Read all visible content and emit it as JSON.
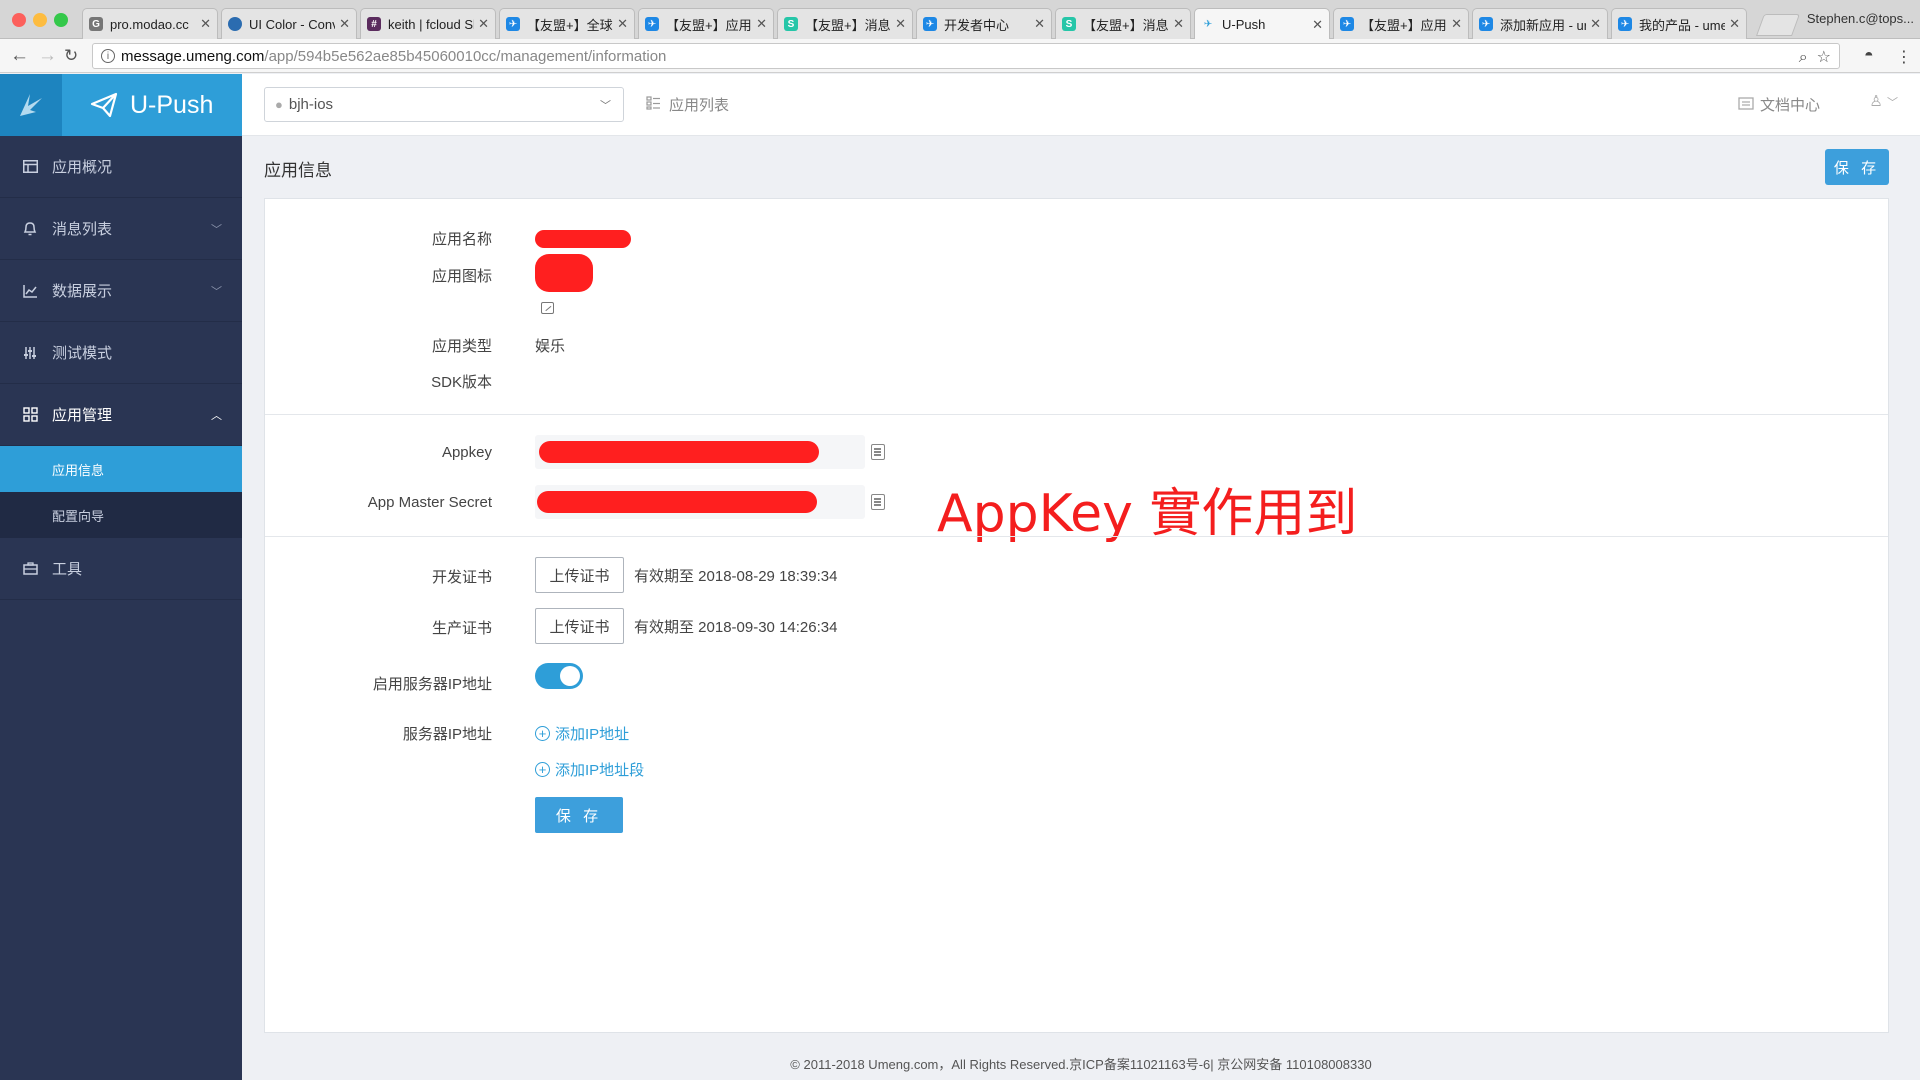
{
  "browser": {
    "tabs": [
      {
        "title": "pro.modao.cc",
        "icon": "globe-icon"
      },
      {
        "title": "UI Color - Conv",
        "icon": "ui-color-icon"
      },
      {
        "title": "keith | fcloud Sl",
        "icon": "slack-icon"
      },
      {
        "title": "【友盟+】全球",
        "icon": "umeng-icon"
      },
      {
        "title": "【友盟+】应用",
        "icon": "umeng-icon"
      },
      {
        "title": "【友盟+】消息",
        "icon": "umeng-teal-icon"
      },
      {
        "title": "开发者中心",
        "icon": "umeng-icon"
      },
      {
        "title": "【友盟+】消息",
        "icon": "umeng-teal-icon"
      },
      {
        "title": "U-Push",
        "icon": "upush-icon"
      },
      {
        "title": "【友盟+】应用",
        "icon": "umeng-icon"
      },
      {
        "title": "添加新应用 - ur",
        "icon": "umeng-icon"
      },
      {
        "title": "我的产品 - ume",
        "icon": "umeng-icon"
      }
    ],
    "active_tab": 8,
    "profile": "Stephen.c@tops...",
    "url_host": "message.umeng.com",
    "url_path": "/app/594b5e562ae85b45060010cc/management/information"
  },
  "sidebar": {
    "brand": "U-Push",
    "items": [
      {
        "label": "应用概况",
        "icon": "overview-icon"
      },
      {
        "label": "消息列表",
        "icon": "bell-icon",
        "chevron": "down"
      },
      {
        "label": "数据展示",
        "icon": "chart-icon",
        "chevron": "down"
      },
      {
        "label": "测试模式",
        "icon": "sliders-icon"
      },
      {
        "label": "应用管理",
        "icon": "grid-icon",
        "chevron": "up"
      },
      {
        "label": "工具",
        "icon": "toolbox-icon"
      }
    ],
    "subitems": [
      {
        "label": "应用信息",
        "active": true
      },
      {
        "label": "配置向导",
        "active": false
      }
    ]
  },
  "topbar": {
    "app_select": "bjh-ios",
    "app_list": "应用列表",
    "docs": "文档中心"
  },
  "page": {
    "title": "应用信息",
    "save_label": "保 存"
  },
  "info": {
    "name_label": "应用名称",
    "icon_label": "应用图标",
    "type_label": "应用类型",
    "type_value": "娱乐",
    "sdk_label": "SDK版本"
  },
  "keys": {
    "appkey_label": "Appkey",
    "secret_label": "App Master Secret",
    "annotation": "AppKey 實作用到"
  },
  "certs": {
    "dev_label": "开发证书",
    "prod_label": "生产证书",
    "upload_label": "上传证书",
    "dev_expiry": "有效期至 2018-08-29 18:39:34",
    "prod_expiry": "有效期至 2018-09-30 14:26:34",
    "server_ip_toggle_label": "启用服务器IP地址",
    "server_ip_toggle_on": true,
    "server_ip_label": "服务器IP地址",
    "add_ip": "添加IP地址",
    "add_ip_range": "添加IP地址段",
    "save_label": "保 存"
  },
  "footer": "© 2011-2018 Umeng.com，All Rights Reserved.京ICP备案11021163号-6| 京公网安备 110108008330",
  "colors": {
    "accent": "#2e9ed8",
    "sidebar": "#2a3553",
    "redaction": "#ff1f1f"
  }
}
